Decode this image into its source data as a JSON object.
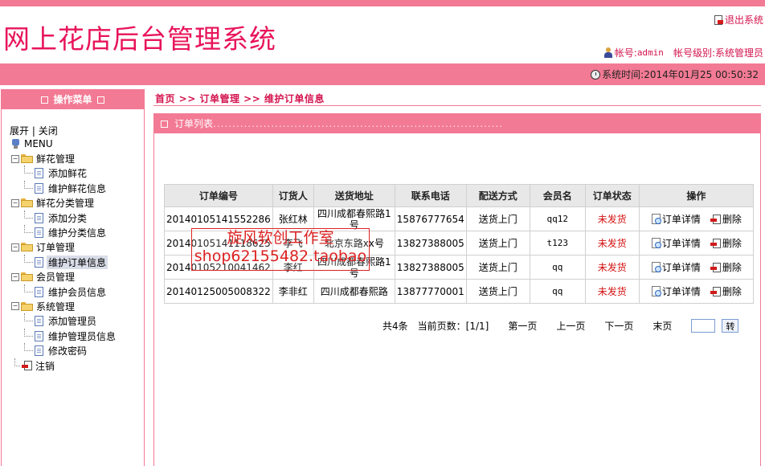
{
  "header": {
    "title": "网上花店后台管理系统",
    "logout": "退出系统",
    "account_label": "帐号:",
    "account_value": "admin",
    "level_label": "帐号级别:",
    "level_value": "系统管理员",
    "time_label": "系统时间:",
    "time_value": "2014年01月25 00:50:32"
  },
  "sidebar": {
    "title": "操作菜单",
    "expand": "展开",
    "divider": "|",
    "collapse": "关闭",
    "root": "MENU",
    "groups": [
      {
        "label": "鲜花管理",
        "items": [
          "添加鲜花",
          "维护鲜花信息"
        ]
      },
      {
        "label": "鲜花分类管理",
        "items": [
          "添加分类",
          "维护分类信息"
        ]
      },
      {
        "label": "订单管理",
        "items": [
          "维护订单信息"
        ]
      },
      {
        "label": "会员管理",
        "items": [
          "维护会员信息"
        ]
      },
      {
        "label": "系统管理",
        "items": [
          "添加管理员",
          "维护管理员信息",
          "修改密码"
        ]
      }
    ],
    "logout": "注销"
  },
  "breadcrumb": "首页 >> 订单管理 >> 维护订单信息",
  "panel": {
    "title": "订单列表",
    "dots": "..........................................................................."
  },
  "table": {
    "headers": [
      "订单编号",
      "订货人",
      "送货地址",
      "联系电话",
      "配送方式",
      "会员名",
      "订单状态",
      "操作"
    ],
    "rows": [
      {
        "id": "20140105141552286",
        "name": "张红林",
        "addr": "四川成都春熙路1号",
        "phone": "15876777654",
        "ship": "送货上门",
        "member": "qq12",
        "status": "未发货"
      },
      {
        "id": "20140105141118625",
        "name": "李飞",
        "addr": "北京东路xx号",
        "phone": "13827388005",
        "ship": "送货上门",
        "member": "t123",
        "status": "未发货"
      },
      {
        "id": "20140105210041462",
        "name": "李红",
        "addr": "四川成都春熙路1号",
        "phone": "13827388005",
        "ship": "送货上门",
        "member": "qq",
        "status": "未发货"
      },
      {
        "id": "20140125005008322",
        "name": "李非红",
        "addr": "四川成都春熙路",
        "phone": "13877770001",
        "ship": "送货上门",
        "member": "qq",
        "status": "未发货"
      }
    ],
    "detail_label": "订单详情",
    "delete_label": "删除"
  },
  "pager": {
    "total": "共4条",
    "current": "当前页数：[1/1]",
    "first": "第一页",
    "prev": "上一页",
    "next": "下一页",
    "last": "末页",
    "go": "转"
  },
  "watermark": {
    "line1": "旋风软创工作室",
    "line2": "shop62155482.taobao"
  },
  "colors": {
    "accent": "#f37a94",
    "title": "#e8145a",
    "link": "#d4144e",
    "status": "#d41010"
  }
}
